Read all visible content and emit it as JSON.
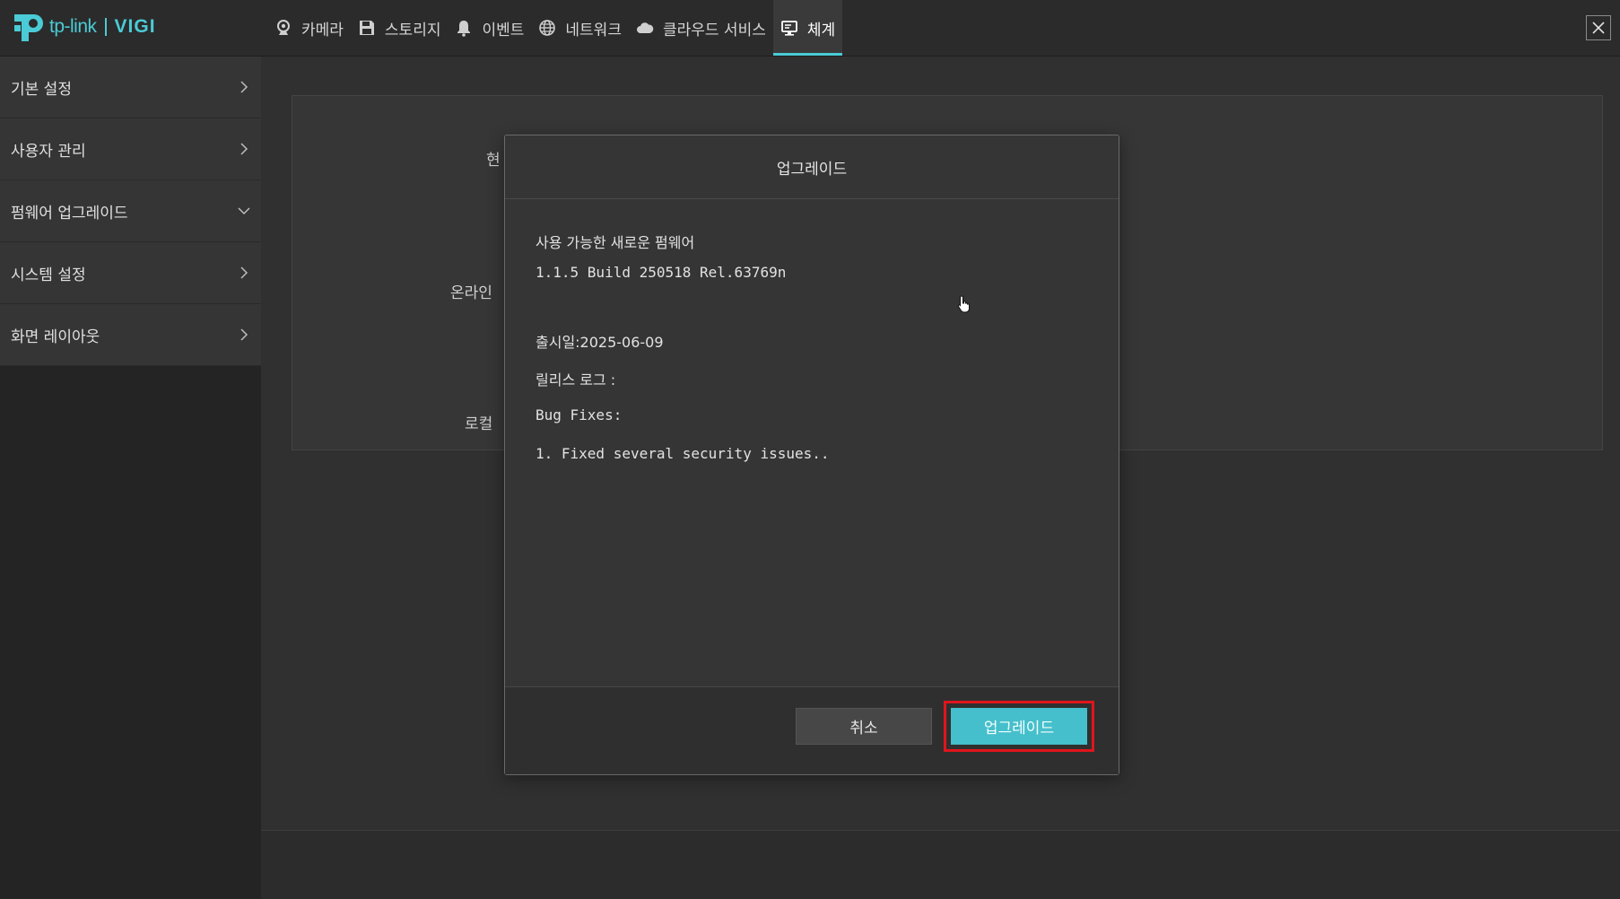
{
  "brand": {
    "logo_text": "tp-link",
    "product": "VIGI"
  },
  "nav": {
    "items": [
      {
        "label": "카메라",
        "icon": "camera-icon"
      },
      {
        "label": "스토리지",
        "icon": "floppy-disk-icon"
      },
      {
        "label": "이벤트",
        "icon": "bell-icon"
      },
      {
        "label": "네트워크",
        "icon": "globe-icon"
      },
      {
        "label": "클라우드 서비스",
        "icon": "cloud-icon"
      },
      {
        "label": "체계",
        "icon": "monitor-icon"
      }
    ],
    "active_index": 5,
    "accent_color": "#4acbd6"
  },
  "sidebar": {
    "items": [
      {
        "label": "기본 설정",
        "icon": "chevron-right-icon"
      },
      {
        "label": "사용자 관리",
        "icon": "chevron-right-icon"
      },
      {
        "label": "펌웨어 업그레이드",
        "icon": "chevron-down-icon"
      },
      {
        "label": "시스템 설정",
        "icon": "chevron-right-icon"
      },
      {
        "label": "화면 레이아웃",
        "icon": "chevron-right-icon"
      }
    ]
  },
  "background_labels": {
    "current": "현",
    "online": "온라인 ",
    "local": "로컬 "
  },
  "modal": {
    "title": "업그레이드",
    "available_label": "사용 가능한 새로운 펌웨어",
    "version": "1.1.5 Build 250518 Rel.63769n",
    "release_date": "출시일:2025-06-09",
    "release_log_label": "릴리스 로그 :",
    "bug_fixes_label": "Bug Fixes:",
    "fix_1": "1. Fixed several security issues..",
    "cancel_label": "취소",
    "upgrade_label": "업그레이드",
    "upgrade_color": "#45bfcb",
    "highlight_color": "#e0151c"
  }
}
